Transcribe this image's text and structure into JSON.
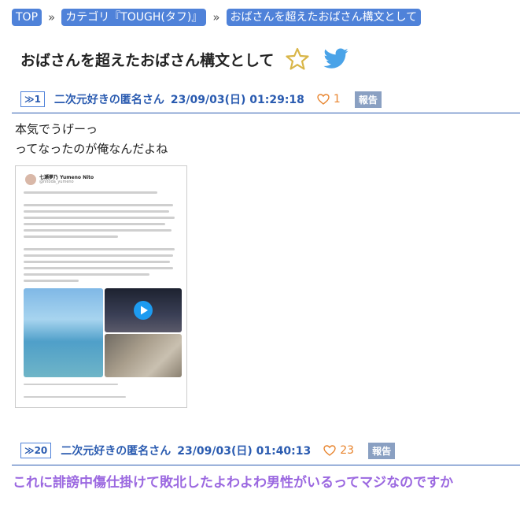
{
  "breadcrumb": {
    "items": [
      "TOP",
      "カテゴリ『TOUGH(タフ)』",
      "おばさんを超えたおばさん構文として"
    ],
    "separator": "»"
  },
  "page": {
    "title": "おばさんを超えたおばさん構文として"
  },
  "posts": [
    {
      "number": "1",
      "name": "二次元好きの匿名さん",
      "date": "23/09/03(日) 01:29:18",
      "likes": "1",
      "report_label": "報告",
      "body_lines": [
        "本気でうげーっ",
        "ってなったのが俺なんだよね"
      ],
      "image": {
        "tweet_name": "七瀬夢乃 Yumeno Nito",
        "tweet_handle": "@nitoda_yumeno"
      }
    },
    {
      "number": "20",
      "name": "二次元好きの匿名さん",
      "date": "23/09/03(日) 01:40:13",
      "likes": "23",
      "report_label": "報告",
      "body_lines": [
        "これに誹謗中傷仕掛けて敗北したよわよわ男性がいるってマジなのですか"
      ]
    }
  ],
  "icons": {
    "post_number": "double-chevron-right-icon",
    "heart": "heart-icon",
    "favorite": "star-icon",
    "share": "twitter-icon"
  },
  "colors": {
    "accent": "#4f82d9",
    "link": "#2a5bb0",
    "heart": "#e8852f",
    "report": "#8aa0c2",
    "highlight_text": "#9b68e0",
    "star": "#d9b648",
    "twitter": "#4aa3e8"
  }
}
